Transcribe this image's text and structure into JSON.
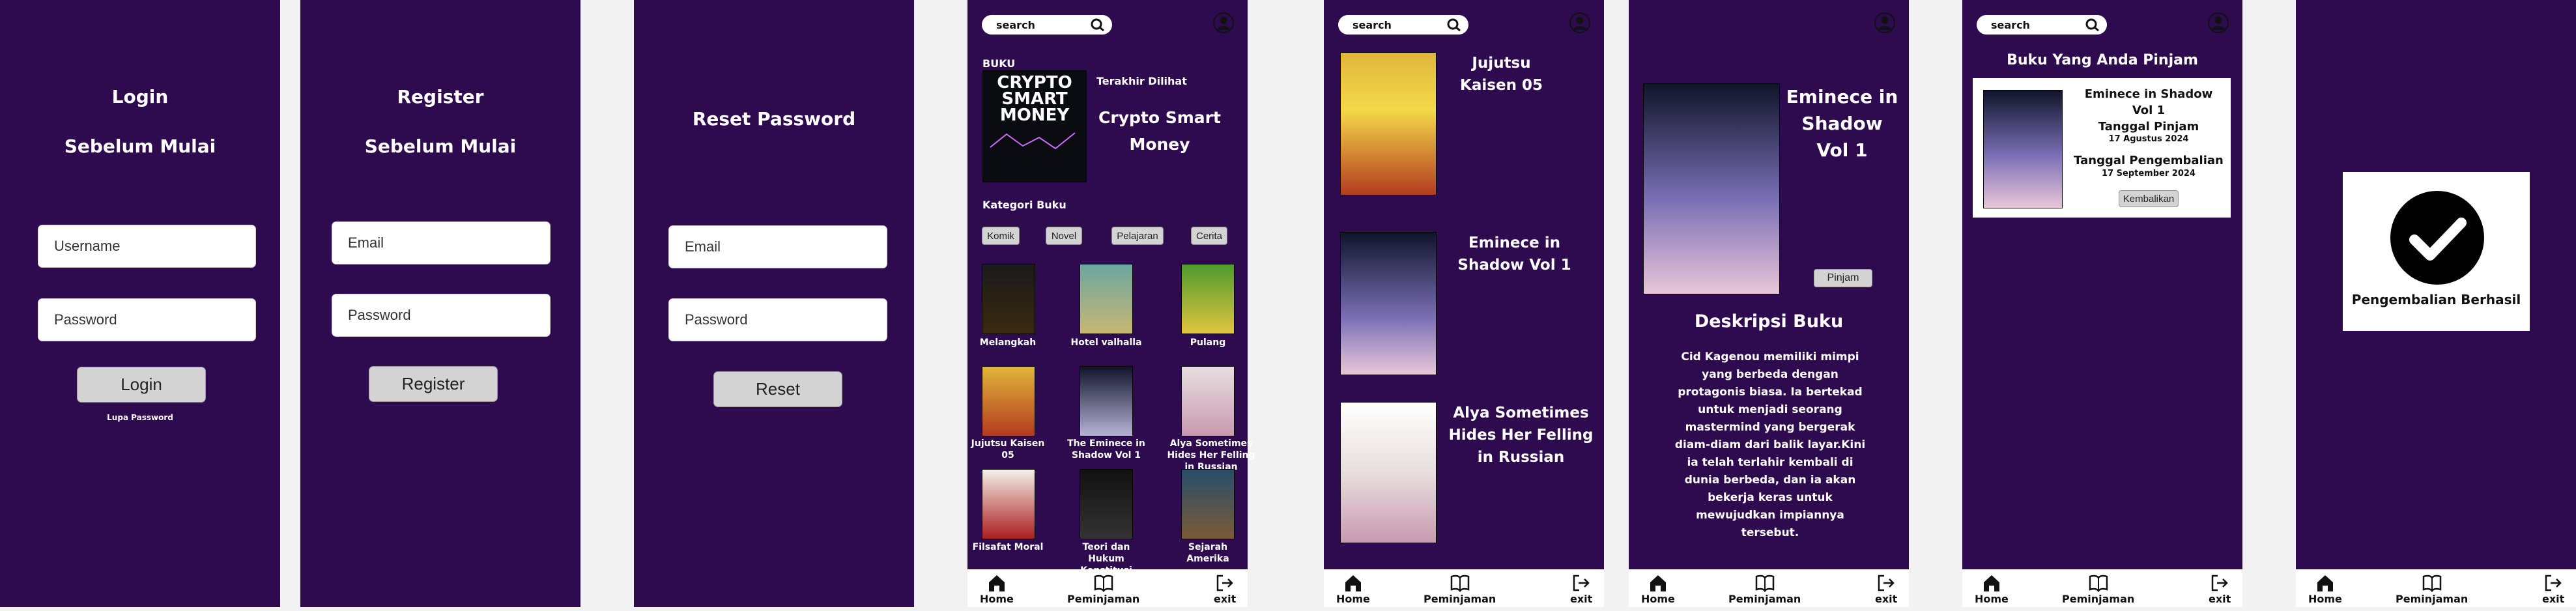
{
  "login": {
    "title": "Login",
    "subtitle": "Sebelum Mulai",
    "username_ph": "Username",
    "password_ph": "Password",
    "button": "Login",
    "forgot": "Lupa Password"
  },
  "register": {
    "title": "Register",
    "subtitle": "Sebelum Mulai",
    "email_ph": "Email",
    "password_ph": "Password",
    "button": "Register"
  },
  "reset": {
    "title": "Reset Password",
    "email_ph": "Email",
    "password_ph": "Password",
    "button": "Reset"
  },
  "search": {
    "placeholder": "search"
  },
  "nav": {
    "home": "Home",
    "loan": "Peminjaman",
    "exit": "exit"
  },
  "home": {
    "section": "BUKU",
    "recent_label": "Terakhir Dilihat",
    "recent_title": "Crypto Smart Money",
    "cover_text": "CRYPTO SMART MONEY",
    "category_title": "Kategori Buku",
    "categories": [
      "Komik",
      "Novel",
      "Pelajaran",
      "Cerita"
    ],
    "books": [
      "Melangkah",
      "Hotel valhalla",
      "Pulang",
      "Jujutsu Kaisen 05",
      "The Eminece in Shadow Vol 1",
      "Alya Sometimes Hides Her Felling in Russian",
      "Filsafat Moral",
      "Teori dan Hukum Konstitusi",
      "Sejarah Amerika"
    ]
  },
  "list": {
    "items": [
      "Jujutsu Kaisen 05",
      "Eminece in Shadow Vol 1",
      "Alya Sometimes Hides Her Felling in Russian"
    ]
  },
  "detail": {
    "title": "Eminece in Shadow Vol 1",
    "borrow": "Pinjam",
    "desc_title": "Deskripsi Buku",
    "desc": "Cid Kagenou memiliki mimpi yang berbeda dengan protagonis biasa. Ia bertekad untuk menjadi seorang mastermind yang bergerak diam-diam dari balik layar.Kini ia telah terlahir kembali di dunia berbeda, dan ia akan bekerja keras untuk mewujudkan impiannya  tersebut."
  },
  "loan": {
    "title": "Buku Yang Anda Pinjam",
    "book": "Eminece in Shadow Vol 1",
    "borrow_label": "Tanggal Pinjam",
    "borrow_date": "17 Agustus 2024",
    "return_label": "Tanggal Pengembalian",
    "return_date": "17 September 2024",
    "return_button": "Kembalikan"
  },
  "success": {
    "message": "Pengembalian Berhasil"
  },
  "colors": {
    "bg": "#2e0a4e",
    "page": "#f2f2f2"
  }
}
